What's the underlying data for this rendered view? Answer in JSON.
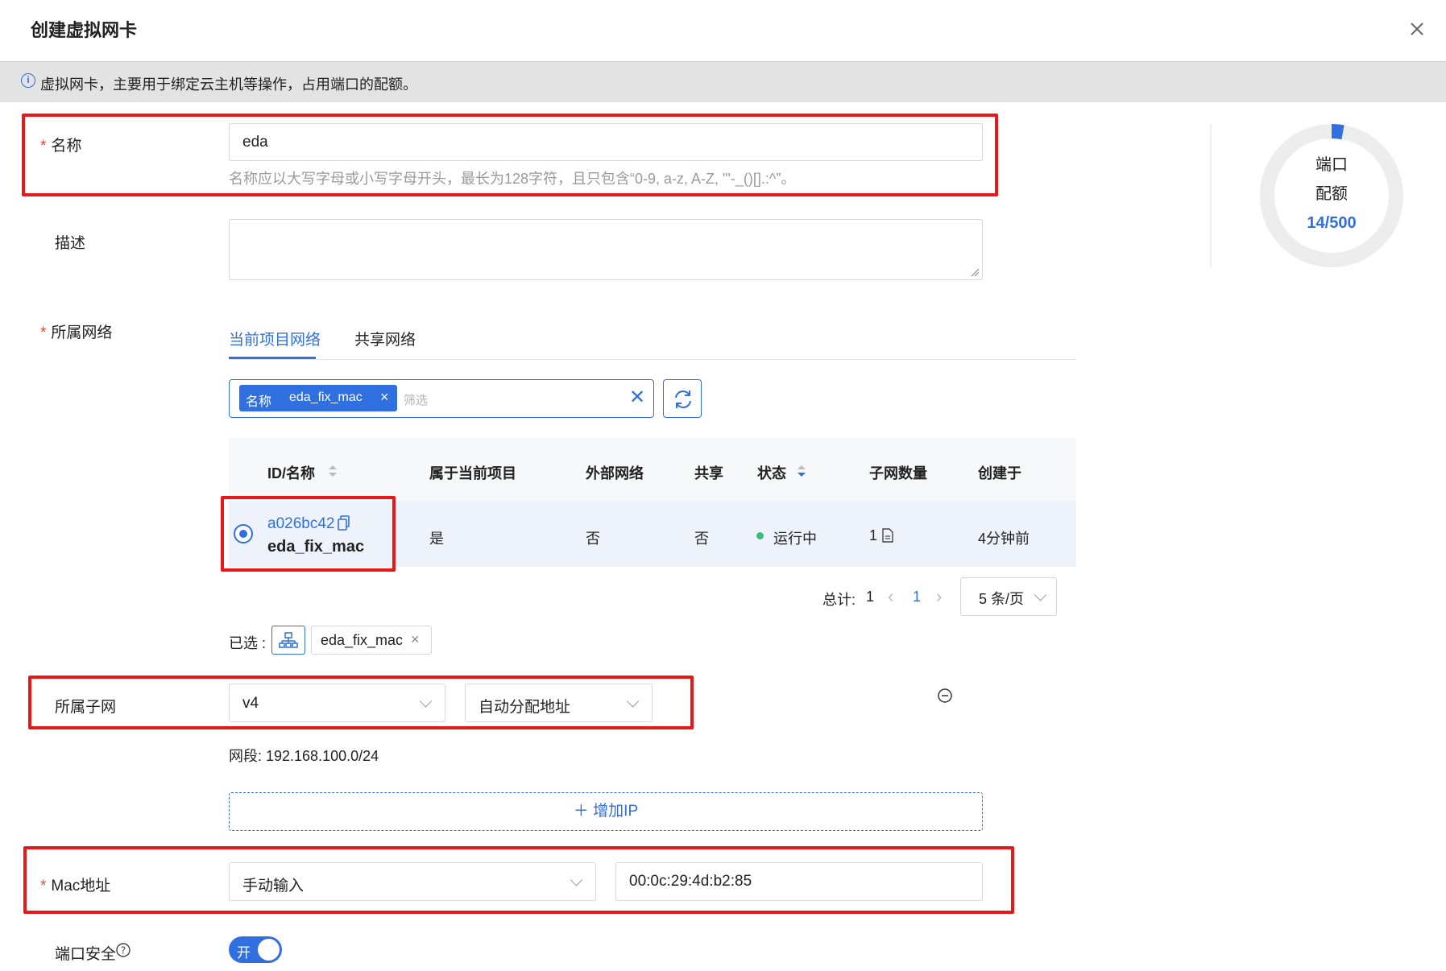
{
  "dialog": {
    "title": "创建虚拟网卡",
    "info": "虚拟网卡，主要用于绑定云主机等操作，占用端口的配额。"
  },
  "form": {
    "name": {
      "label": "名称",
      "value": "eda",
      "hint": "名称应以大写字母或小写字母开头，最长为128字符，且只包含“0-9, a-z, A-Z, \"'-_()[].:^”。"
    },
    "description": {
      "label": "描述",
      "value": ""
    },
    "network": {
      "label": "所属网络",
      "tabs": [
        "当前项目网络",
        "共享网络"
      ],
      "filter": {
        "key": "名称",
        "value": "eda_fix_mac",
        "placeholder": "筛选"
      },
      "columns": [
        "ID/名称",
        "属于当前项目",
        "外部网络",
        "共享",
        "状态",
        "子网数量",
        "创建于"
      ],
      "rows": [
        {
          "id": "a026bc42",
          "name": "eda_fix_mac",
          "in_project": "是",
          "external": "否",
          "shared": "否",
          "status": "运行中",
          "subnets": "1",
          "created": "4分钟前"
        }
      ],
      "pager": {
        "total_label": "总计:",
        "total": "1",
        "page": "1",
        "page_size": "5 条/页"
      },
      "selected": {
        "label": "已选 :",
        "tag": "eda_fix_mac"
      }
    },
    "subnet": {
      "label": "所属子网",
      "subnet_value": "v4",
      "ip_mode": "自动分配地址",
      "segment": "网段: 192.168.100.0/24",
      "add_ip": "增加IP"
    },
    "mac": {
      "label": "Mac地址",
      "mode": "手动输入",
      "value": "00:0c:29:4d:b2:85"
    },
    "port_security": {
      "label": "端口安全",
      "toggle": "开",
      "on": true
    }
  },
  "quota": {
    "line1": "端口",
    "line2": "配额",
    "used": 14,
    "total": 500,
    "text": "14/500"
  },
  "colors": {
    "accent": "#2f6fe0",
    "highlight": "#e81818",
    "running": "#35c07a"
  }
}
